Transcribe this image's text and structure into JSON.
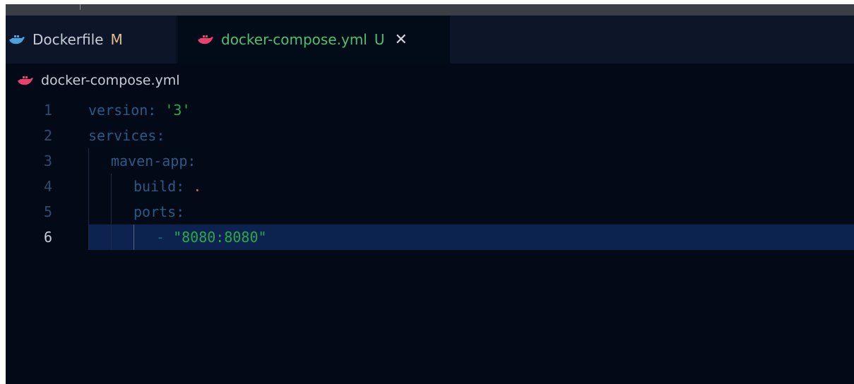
{
  "tabs": [
    {
      "label": "Dockerfile",
      "badge": "M",
      "active": false
    },
    {
      "label": "docker-compose.yml",
      "badge": "U",
      "active": true,
      "close": "✕"
    }
  ],
  "breadcrumb": {
    "file": "docker-compose.yml"
  },
  "icons": {
    "file_icon": "docker-whale-icon",
    "close_icon": "close-icon"
  },
  "colors": {
    "editor_bg": "#010a16",
    "tabbar_bg": "#0d1628",
    "current_line": "#0c2350",
    "string": "#2aa84a",
    "key": "#2a5a86",
    "modified_badge": "#e2c08d",
    "untracked_badge": "#4ec070",
    "docker_icon_blue": "#4aa3df",
    "docker_icon_pink": "#e8436f"
  },
  "editor": {
    "lines": [
      {
        "number": "1",
        "key": "version",
        "sep": ": ",
        "value": "'3'"
      },
      {
        "number": "2",
        "key": "services",
        "sep": ":",
        "value": ""
      },
      {
        "number": "3",
        "key": "maven-app",
        "sep": ":",
        "value": ""
      },
      {
        "number": "4",
        "key": "build",
        "sep": ": ",
        "value": "."
      },
      {
        "number": "5",
        "key": "ports",
        "sep": ":",
        "value": ""
      },
      {
        "number": "6",
        "dash": "- ",
        "value": "\"8080:8080\""
      }
    ],
    "current_line": "6"
  }
}
